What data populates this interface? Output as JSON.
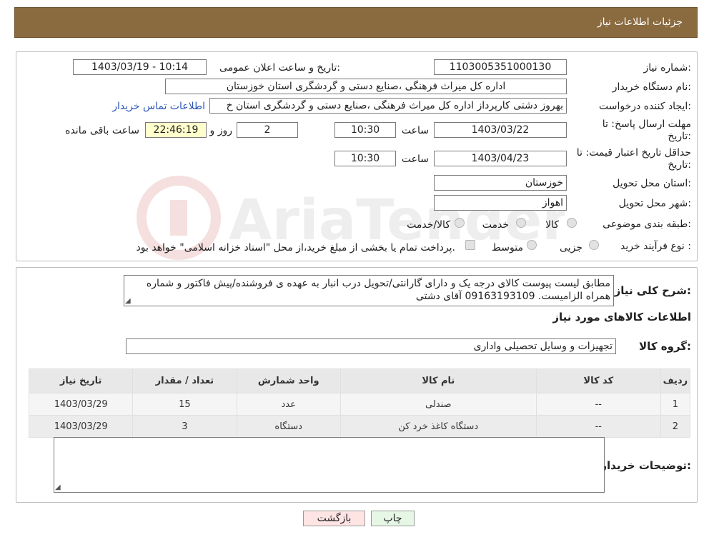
{
  "header": {
    "title": "جزئیات اطلاعات نیاز"
  },
  "info": {
    "need_number_label": "شماره نیاز:",
    "need_number": "1103005351000130",
    "announce_label": "تاریخ و ساعت اعلان عمومی:",
    "announce_value": "1403/03/19 - 10:14",
    "buyer_org_label": "نام دستگاه خریدار:",
    "buyer_org": "اداره کل میراث فرهنگی ،صنایع دستی و گردشگری استان خوزستان",
    "creator_label": "ایجاد کننده درخواست:",
    "creator": "بهروز دشتی کارپرداز اداره کل میراث فرهنگی ،صنایع دستی و گردشگری استان خ",
    "contact_link": "اطلاعات تماس خریدار",
    "reply_deadline_label": "مهلت ارسال پاسخ: تا تاریخ:",
    "reply_date": "1403/03/22",
    "hour_label": "ساعت",
    "reply_time": "10:30",
    "days_value": "2",
    "days_label": "روز و",
    "remaining_time": "22:46:19",
    "remaining_label": "ساعت باقی مانده",
    "price_validity_label": "حداقل تاریخ اعتبار قیمت: تا تاریخ:",
    "price_validity_date": "1403/04/23",
    "price_validity_time": "10:30",
    "province_label": "استان محل تحویل:",
    "province": "خوزستان",
    "city_label": "شهر محل تحویل:",
    "city": "اهواز",
    "category_label": "طبقه بندی موضوعی:",
    "category_options": [
      "کالا",
      "خدمت",
      "کالا/خدمت"
    ],
    "process_label": "نوع فرآیند خرید :",
    "process_options": [
      "جزیی",
      "متوسط"
    ],
    "process_note": "پرداخت تمام یا بخشی از مبلغ خرید،از محل \"اسناد خزانه اسلامی\" خواهد بود."
  },
  "description": {
    "label": "شرح کلی نیاز:",
    "text": "مطابق لیست پیوست کالای درجه یک و دارای گارانتی/تحویل درب انبار به عهده ی فروشنده/پیش فاکتور و شماره همراه الزامیست. 09163193109 آقای دشتی"
  },
  "goods": {
    "section_title": "اطلاعات کالاهای مورد نیاز",
    "group_label": "گروه کالا:",
    "group_value": "تجهیزات و وسایل تحصیلی واداری",
    "columns": [
      "ردیف",
      "کد کالا",
      "نام کالا",
      "واحد شمارش",
      "تعداد / مقدار",
      "تاریخ نیاز"
    ],
    "rows": [
      {
        "row": "1",
        "code": "--",
        "name": "صندلی",
        "unit": "عدد",
        "qty": "15",
        "date": "1403/03/29"
      },
      {
        "row": "2",
        "code": "--",
        "name": "دستگاه کاغذ خرد کن",
        "unit": "دستگاه",
        "qty": "3",
        "date": "1403/03/29"
      }
    ]
  },
  "buyer_notes": {
    "label": "توضیحات خریدار:",
    "text": ""
  },
  "buttons": {
    "print": "چاپ",
    "back": "بازگشت"
  },
  "watermark": {
    "text": "AriaTender.neT"
  }
}
